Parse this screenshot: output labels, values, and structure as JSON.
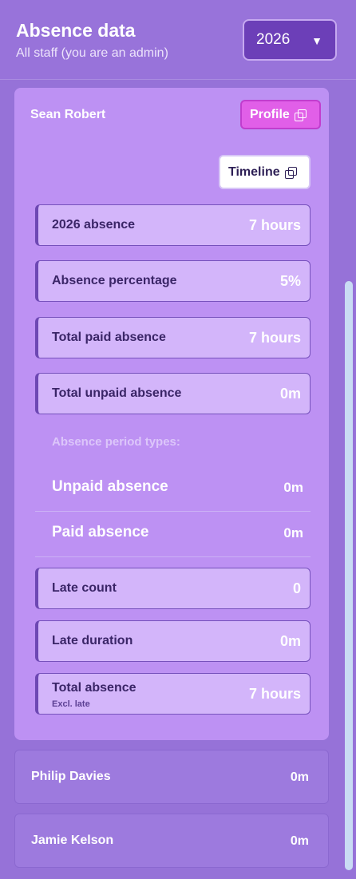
{
  "header": {
    "title": "Absence data",
    "subtitle": "All staff (you are an admin)",
    "year_select": {
      "value": "2026"
    }
  },
  "person": {
    "name": "Sean Robert",
    "profile_button": "Profile",
    "timeline_button": "Timeline",
    "stats": [
      {
        "label": "2026 absence",
        "value": "7 hours"
      },
      {
        "label": "Absence percentage",
        "value": "5%"
      },
      {
        "label": "Total paid absence",
        "value": "7 hours"
      },
      {
        "label": "Total unpaid absence",
        "value": "0m"
      }
    ],
    "period_types_heading": "Absence period types:",
    "period_types": [
      {
        "label": "Unpaid absence",
        "value": "0m"
      },
      {
        "label": "Paid absence",
        "value": "0m"
      }
    ],
    "late": [
      {
        "label": "Late count",
        "value": "0"
      },
      {
        "label": "Late duration",
        "value": "0m"
      }
    ],
    "total": {
      "label": "Total absence",
      "sublabel": "Excl. late",
      "value": "7 hours"
    }
  },
  "staff_rows": [
    {
      "name": "Philip Davies",
      "value": "0m"
    },
    {
      "name": "Jamie Kelson",
      "value": "0m"
    }
  ],
  "icons": {
    "external": "external-link-icon",
    "caret": "caret-down-icon"
  }
}
